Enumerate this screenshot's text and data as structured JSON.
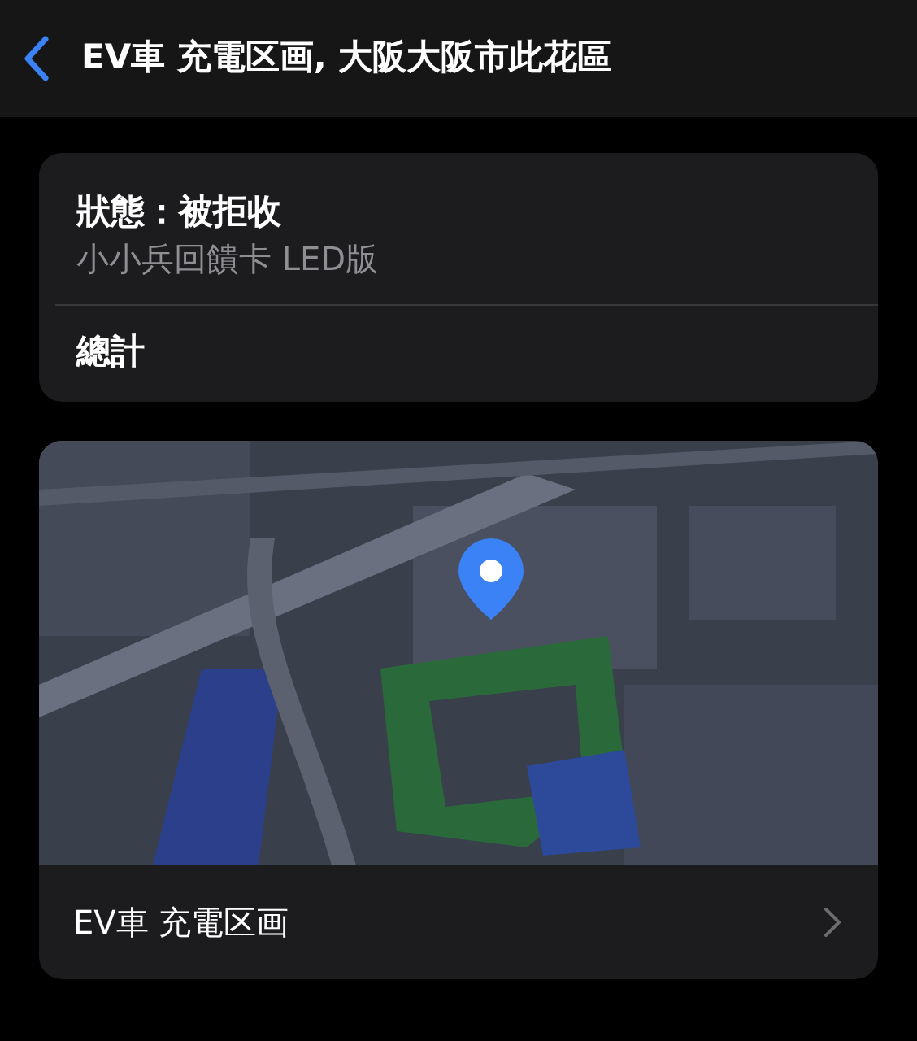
{
  "nav": {
    "title": "EV車 充電区画, 大阪大阪市此花區"
  },
  "info": {
    "status": "狀態：被拒收",
    "item": "小小兵回饋卡 LED版",
    "total": "總計"
  },
  "place": {
    "name": "EV車 充電区画"
  }
}
